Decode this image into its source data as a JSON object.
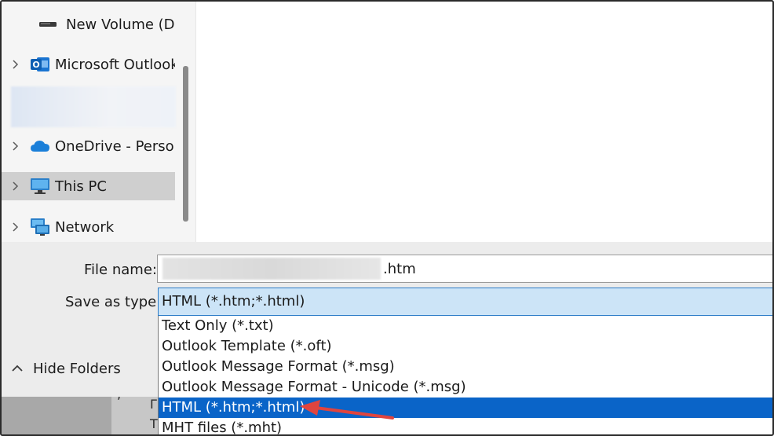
{
  "nav": {
    "items": [
      {
        "label": "New Volume (D:",
        "icon": "drive-icon",
        "expandable": false
      },
      {
        "label": "Microsoft Outlook",
        "icon": "outlook-icon",
        "expandable": true
      },
      {
        "label": "OneDrive - Person",
        "icon": "onedrive-icon",
        "expandable": true
      },
      {
        "label": "This PC",
        "icon": "monitor-icon",
        "expandable": true,
        "selected": true
      },
      {
        "label": "Network",
        "icon": "network-icon",
        "expandable": true
      }
    ]
  },
  "form": {
    "file_name_label": "File name:",
    "file_name_value": ".htm",
    "save_as_type_label": "Save as type:",
    "save_as_type_value": "HTML (*.htm;*.html)"
  },
  "hide_folders_label": "Hide Folders",
  "dropdown": {
    "options": [
      "Text Only (*.txt)",
      "Outlook Template (*.oft)",
      "Outlook Message Format (*.msg)",
      "Outlook Message Format - Unicode (*.msg)",
      "HTML (*.htm;*.html)",
      "MHT files (*.mht)"
    ],
    "selected_index": 4
  },
  "colors": {
    "selection_blue": "#0a64c8",
    "combo_highlight": "#cce4f7",
    "annotation_arrow": "#e0443e"
  }
}
